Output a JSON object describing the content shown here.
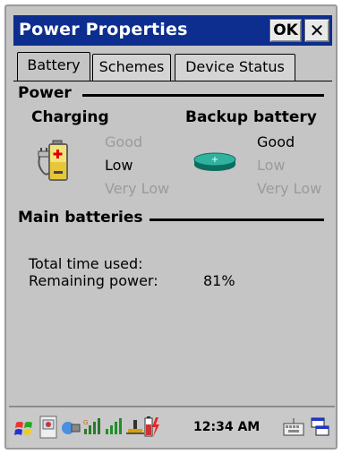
{
  "window": {
    "title": "Power Properties",
    "ok_label": "OK",
    "close_label": "✕"
  },
  "tabs": [
    {
      "label": "Battery",
      "selected": true
    },
    {
      "label": "Schemes",
      "selected": false
    },
    {
      "label": "Device Status",
      "selected": false
    }
  ],
  "power": {
    "section_title": "Power",
    "charging": {
      "title": "Charging",
      "levels": [
        "Good",
        "Low",
        "Very Low"
      ],
      "active_level": "Low"
    },
    "backup": {
      "title": "Backup battery",
      "levels": [
        "Good",
        "Low",
        "Very Low"
      ],
      "active_level": "Good"
    }
  },
  "main_batteries": {
    "section_title": "Main batteries",
    "total_time_label": "Total time used:",
    "remaining_label": "Remaining power:",
    "remaining_value": "81%"
  },
  "taskbar": {
    "clock": "12:34 AM",
    "icons": [
      "start-flag-icon",
      "desktop-icon",
      "network-icon",
      "signal-bars-icon",
      "signal-strength-icon",
      "usb-icon",
      "battery-charging-icon",
      "keyboard-icon",
      "windows-switch-icon"
    ]
  },
  "colors": {
    "title_bar": "#0d2e8f",
    "background": "#c5c5c5",
    "dim_text": "#9b9b9b"
  }
}
